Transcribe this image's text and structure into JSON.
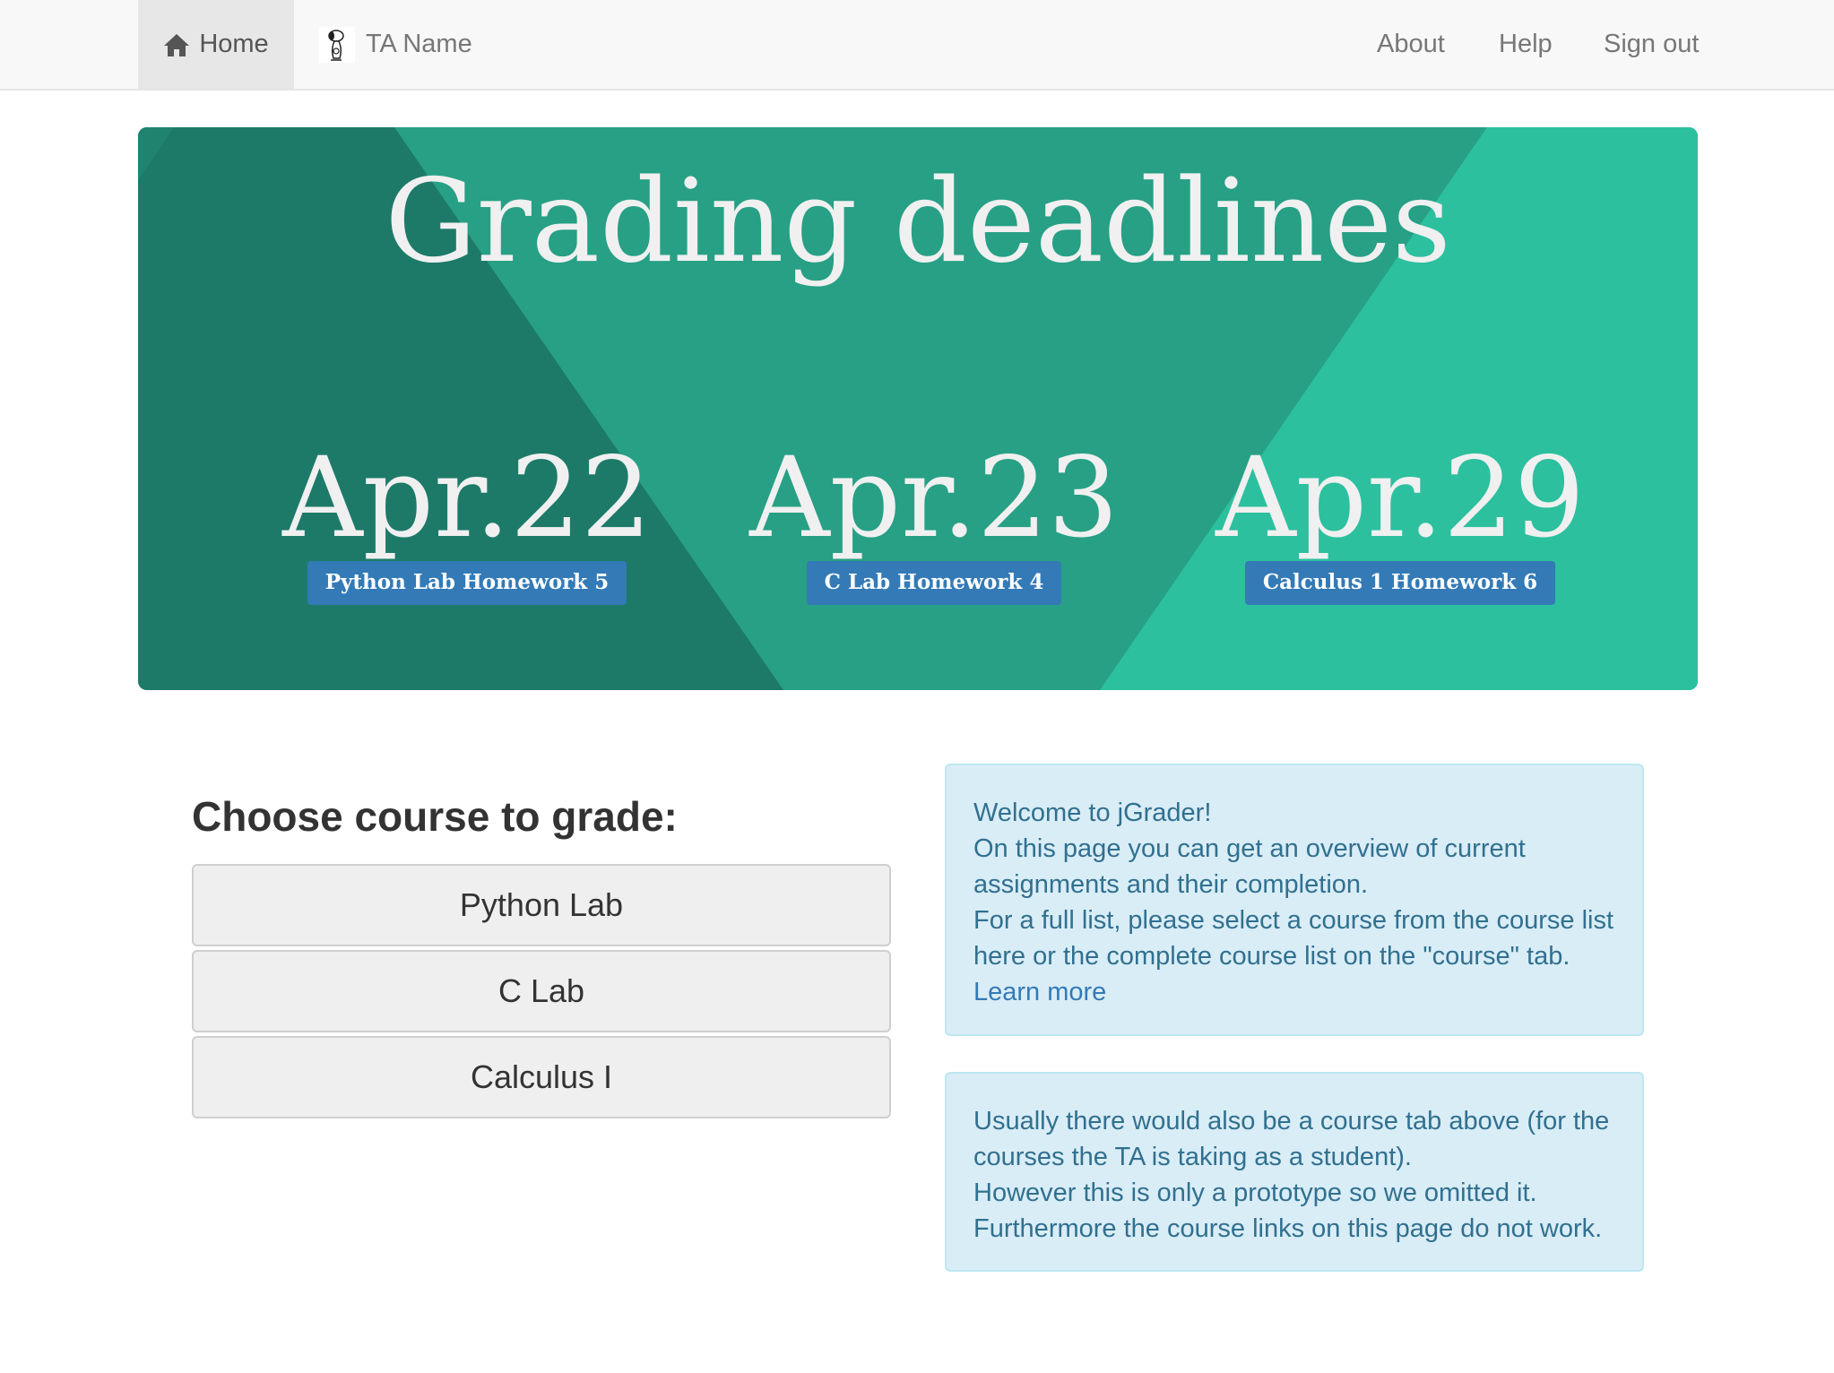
{
  "navbar": {
    "home_label": "Home",
    "user_label": "TA Name",
    "about_label": "About",
    "help_label": "Help",
    "signout_label": "Sign out"
  },
  "hero": {
    "title": "Grading deadlines",
    "deadlines": [
      {
        "date": "Apr.22",
        "assignment": "Python Lab Homework 5"
      },
      {
        "date": "Apr.23",
        "assignment": "C Lab Homework 4"
      },
      {
        "date": "Apr.29",
        "assignment": "Calculus 1 Homework 6"
      }
    ]
  },
  "courses": {
    "heading": "Choose course to grade:",
    "items": [
      "Python Lab",
      "C Lab",
      "Calculus I"
    ]
  },
  "info": {
    "welcome": {
      "lines": [
        "Welcome to jGrader!",
        "On this page you can get an overview of current assignments and their completion.",
        "For a full list, please select a course from the course list here or the complete course list on the \"course\" tab."
      ],
      "link_label": "Learn more"
    },
    "note": {
      "lines": [
        "Usually there would also be a course tab above (for the courses the TA is taking as a student).",
        "However this is only a prototype so we omitted it.",
        "Furthermore the course links on this page do not work."
      ]
    }
  },
  "colors": {
    "hero_dark": "#1d7a69",
    "hero_mid": "#27a085",
    "hero_light": "#2cc09f",
    "label_blue": "#337ab7",
    "info_bg": "#d9edf7",
    "info_text": "#31708f"
  }
}
